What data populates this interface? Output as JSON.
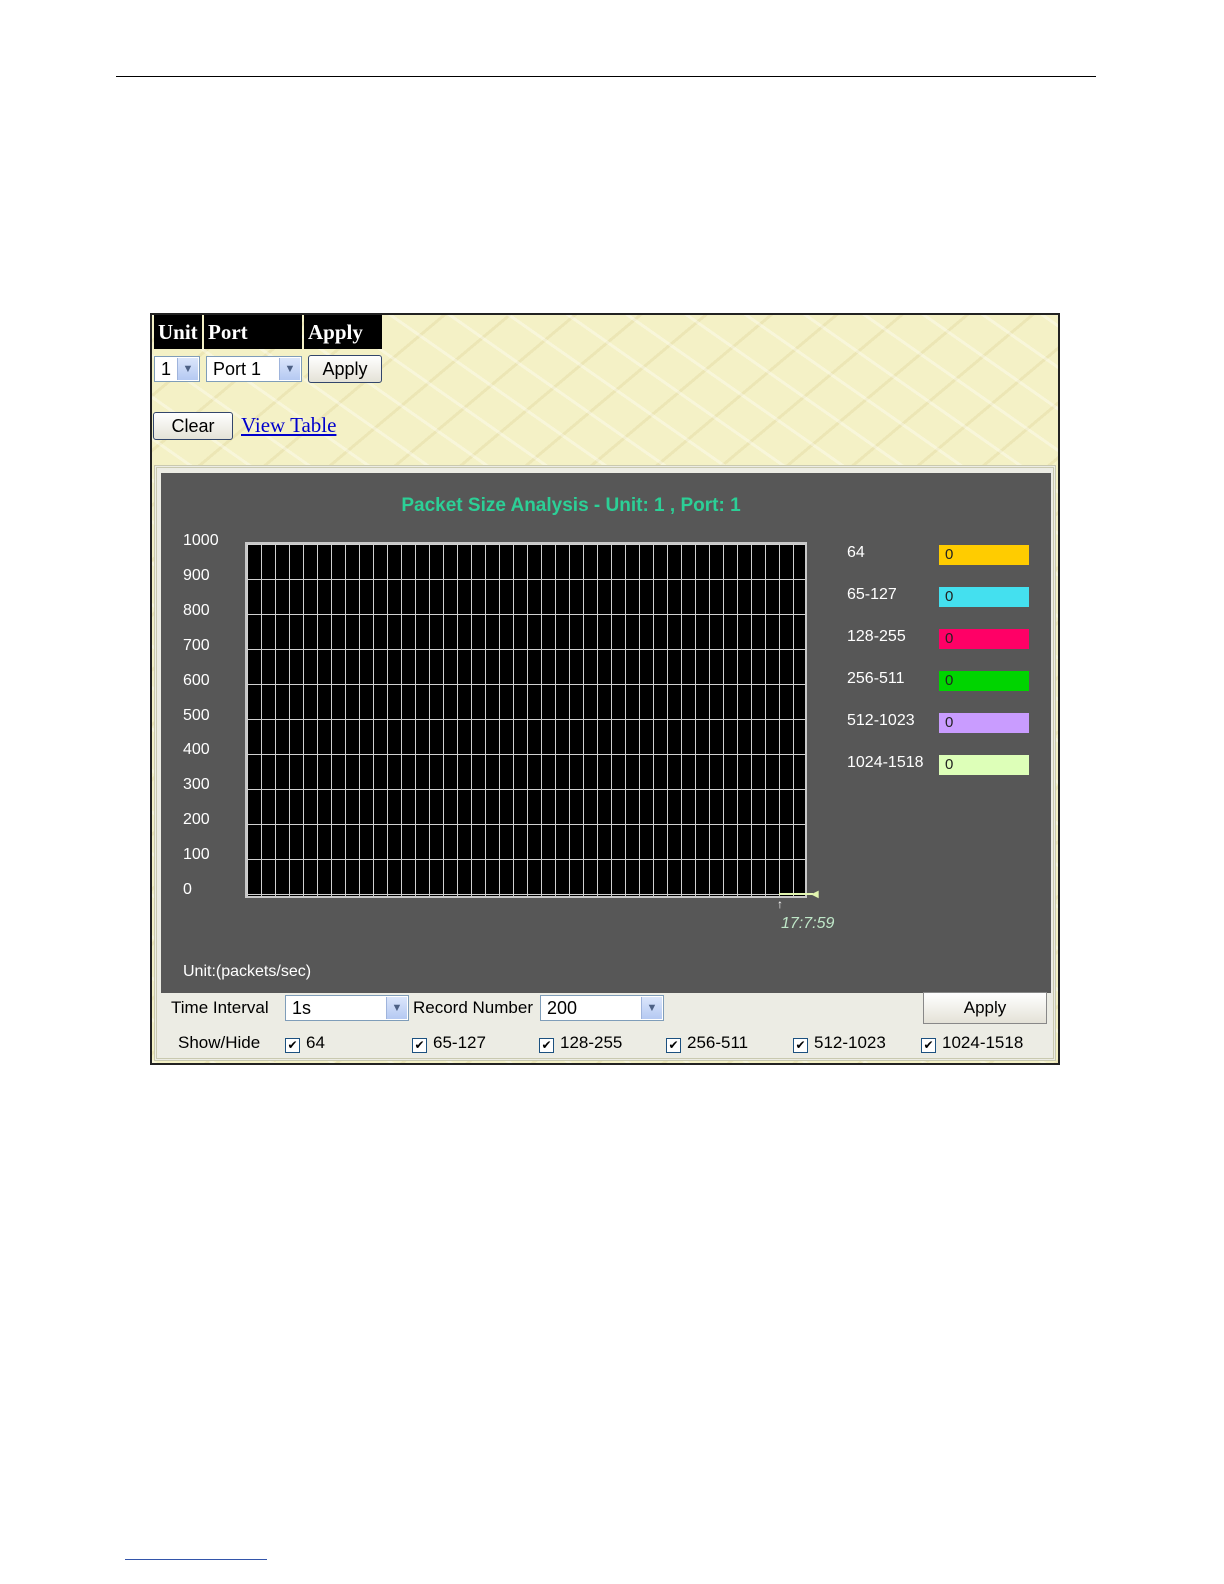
{
  "controls": {
    "unit_header": "Unit",
    "port_header": "Port",
    "apply_header": "Apply",
    "unit_value": "1",
    "port_value": "Port 1",
    "apply_label": "Apply",
    "clear_label": "Clear",
    "view_table_label": "View Table"
  },
  "graph": {
    "title": "Packet Size Analysis  - Unit: 1 , Port: 1",
    "unit_label": "Unit:(packets/sec)",
    "timestamp": "17:7:59"
  },
  "chart_data": {
    "type": "line",
    "title": "Packet Size Analysis  - Unit: 1 , Port: 1",
    "ylabel": "Unit:(packets/sec)",
    "ylim": [
      0,
      1000
    ],
    "yticks": [
      "1000",
      "900",
      "800",
      "700",
      "600",
      "500",
      "400",
      "300",
      "200",
      "100",
      "0"
    ],
    "x": [
      "17:7:59"
    ],
    "grid": true,
    "legend_position": "right",
    "series": [
      {
        "name": "64",
        "values": [
          0
        ],
        "color": "#ffcc00"
      },
      {
        "name": "65-127",
        "values": [
          0
        ],
        "color": "#44e0ef"
      },
      {
        "name": "128-255",
        "values": [
          0
        ],
        "color": "#ff0066"
      },
      {
        "name": "256-511",
        "values": [
          0
        ],
        "color": "#00d400"
      },
      {
        "name": "512-1023",
        "values": [
          0
        ],
        "color": "#c99cff"
      },
      {
        "name": "1024-1518",
        "values": [
          0
        ],
        "color": "#ddffb8"
      }
    ]
  },
  "legend": [
    {
      "label": "64",
      "value": "0",
      "color": "#ffcc00"
    },
    {
      "label": "65-127",
      "value": "0",
      "color": "#44e0ef"
    },
    {
      "label": "128-255",
      "value": "0",
      "color": "#ff0066"
    },
    {
      "label": "256-511",
      "value": "0",
      "color": "#00d400"
    },
    {
      "label": "512-1023",
      "value": "0",
      "color": "#c99cff"
    },
    {
      "label": "1024-1518",
      "value": "0",
      "color": "#ddffb8"
    }
  ],
  "settings": {
    "time_interval_label": "Time Interval",
    "time_interval_value": "1s",
    "record_number_label": "Record Number",
    "record_number_value": "200",
    "apply_label": "Apply",
    "show_hide_label": "Show/Hide",
    "checkboxes": [
      {
        "label": "64",
        "checked": true
      },
      {
        "label": "65-127",
        "checked": true
      },
      {
        "label": "128-255",
        "checked": true
      },
      {
        "label": "256-511",
        "checked": true
      },
      {
        "label": "512-1023",
        "checked": true
      },
      {
        "label": "1024-1518",
        "checked": true
      }
    ]
  }
}
